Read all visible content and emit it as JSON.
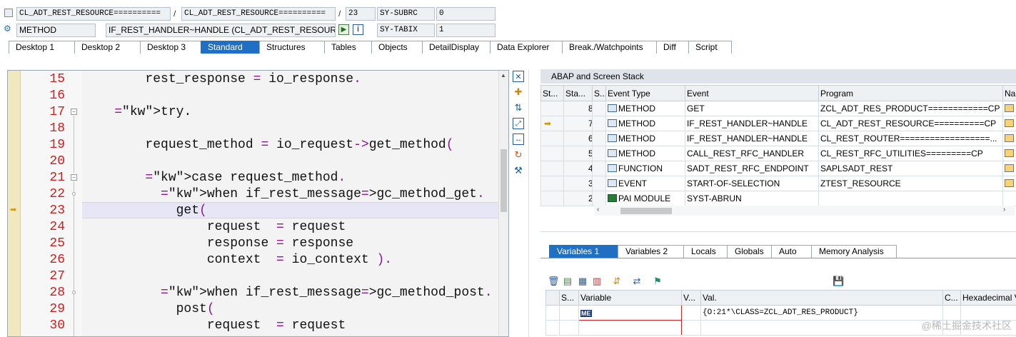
{
  "header": {
    "program_field": "CL_ADT_REST_RESOURCE==========",
    "include_field": "CL_ADT_REST_RESOURCE==========",
    "line_number": "23",
    "sysvar1_name": "SY-SUBRC",
    "sysvar1_value": "0",
    "event_type": "METHOD",
    "event_name": "IF_REST_HANDLER~HANDLE (CL_ADT_REST_RESOURC...",
    "sysvar2_name": "SY-TABIX",
    "sysvar2_value": "1",
    "sep1": "/",
    "sep2": "/"
  },
  "tabs": [
    {
      "label": "Desktop 1",
      "w": 93
    },
    {
      "label": "Desktop 2",
      "w": 93
    },
    {
      "label": "Desktop 3",
      "w": 86
    },
    {
      "label": "Standard",
      "w": 83
    },
    {
      "label": "Structures",
      "w": 92
    },
    {
      "label": "Tables",
      "w": 67
    },
    {
      "label": "Objects",
      "w": 72
    },
    {
      "label": "DetailDisplay",
      "w": 96
    },
    {
      "label": "Data Explorer",
      "w": 102
    },
    {
      "label": "Break./Watchpoints",
      "w": 133
    },
    {
      "label": "Diff",
      "w": 46
    },
    {
      "label": "Script",
      "w": 61
    }
  ],
  "code_lines": [
    {
      "n": "15",
      "text": "        rest_response = io_response."
    },
    {
      "n": "16",
      "text": ""
    },
    {
      "n": "17",
      "text": "    try."
    },
    {
      "n": "18",
      "text": ""
    },
    {
      "n": "19",
      "text": "        request_method = io_request->get_method("
    },
    {
      "n": "20",
      "text": ""
    },
    {
      "n": "21",
      "text": "        case request_method."
    },
    {
      "n": "22",
      "text": "          when if_rest_message=>gc_method_get."
    },
    {
      "n": "23",
      "text": "            get("
    },
    {
      "n": "24",
      "text": "                request  = request"
    },
    {
      "n": "25",
      "text": "                response = response"
    },
    {
      "n": "26",
      "text": "                context  = io_context )."
    },
    {
      "n": "27",
      "text": ""
    },
    {
      "n": "28",
      "text": "          when if_rest_message=>gc_method_post."
    },
    {
      "n": "29",
      "text": "            post("
    },
    {
      "n": "30",
      "text": "                request  = request"
    }
  ],
  "stack_panel": {
    "title": "ABAP and Screen Stack",
    "columns": [
      "St...",
      "Sta...",
      "S...",
      "Event Type",
      "Event",
      "Program",
      "Na..."
    ],
    "rows": [
      {
        "level": "8",
        "event_type": "METHOD",
        "event": "GET",
        "program": "ZCL_ADT_RES_PRODUCT============CP"
      },
      {
        "level": "7",
        "event_type": "METHOD",
        "event": "IF_REST_HANDLER~HANDLE",
        "program": "CL_ADT_REST_RESOURCE==========CP"
      },
      {
        "level": "6",
        "event_type": "METHOD",
        "event": "IF_REST_HANDLER~HANDLE",
        "program": "CL_REST_ROUTER==================..."
      },
      {
        "level": "5",
        "event_type": "METHOD",
        "event": "CALL_REST_RFC_HANDLER",
        "program": "CL_REST_RFC_UTILITIES=========CP"
      },
      {
        "level": "4",
        "event_type": "FUNCTION",
        "event": "SADT_REST_RFC_ENDPOINT",
        "program": "SAPLSADT_REST"
      },
      {
        "level": "3",
        "event_type": "EVENT",
        "event": "START-OF-SELECTION",
        "program": "ZTEST_RESOURCE"
      },
      {
        "level": "2",
        "event_type": "PAI MODULE",
        "event": "SYST-ABRUN",
        "program": ""
      }
    ]
  },
  "variable_tabs": [
    "Variables 1",
    "Variables 2",
    "Locals",
    "Globals",
    "Auto",
    "Memory Analysis"
  ],
  "variables": {
    "columns": [
      "S...",
      "Variable",
      "V...",
      "Val.",
      "C...",
      "Hexadecimal V"
    ],
    "rows": [
      {
        "variable": "ME",
        "value": "{O:21*\\CLASS=ZCL_ADT_RES_PRODUCT}"
      }
    ]
  },
  "watermark": "@稀土掘金技术社区"
}
